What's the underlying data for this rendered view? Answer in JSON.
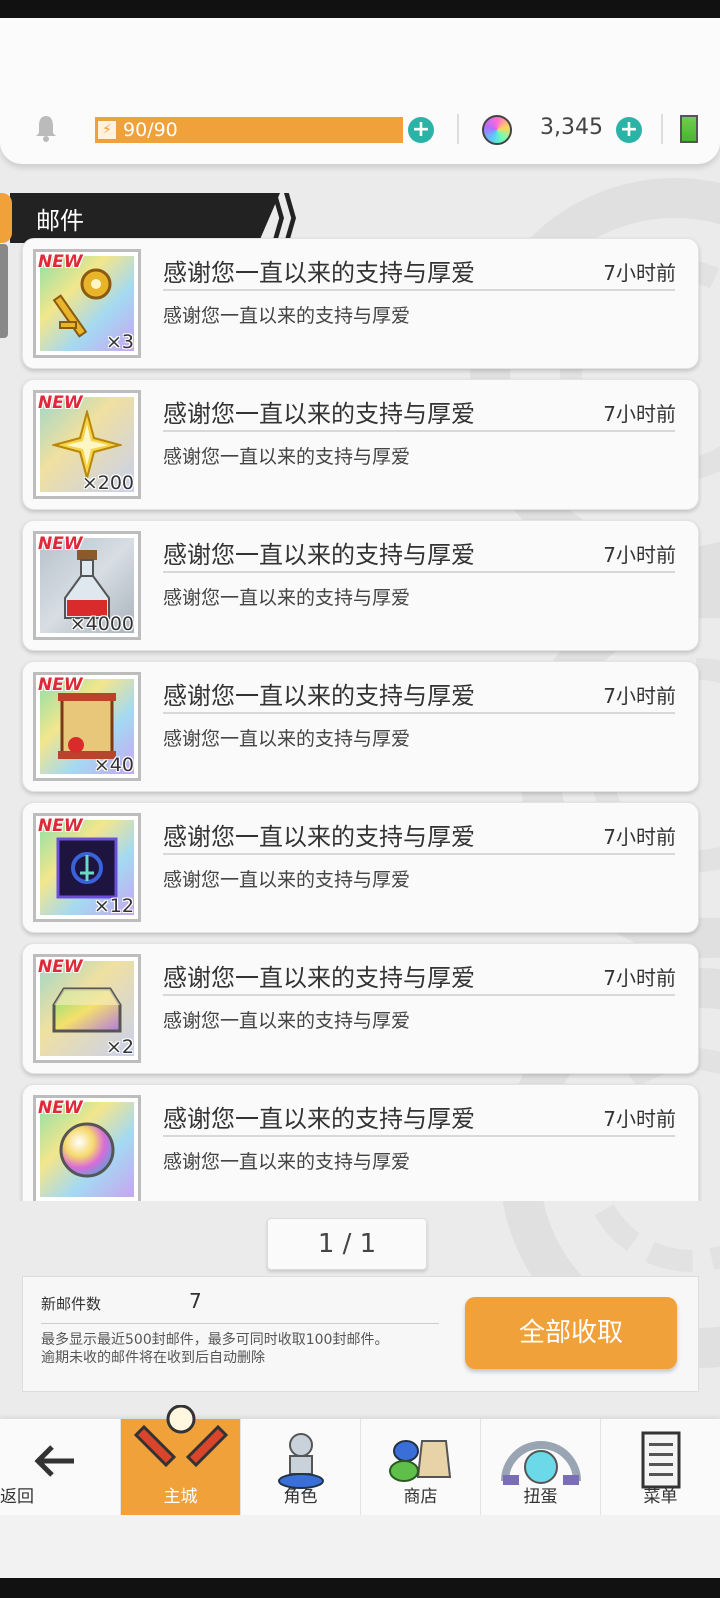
{
  "resources": {
    "energy_current": "90",
    "energy_max": "/90",
    "energy_level": 1.0,
    "gems": "3,345"
  },
  "header": {
    "title": "邮件"
  },
  "mails": [
    {
      "title": "感谢您一直以来的支持与厚爱",
      "subtitle": "感谢您一直以来的支持与厚爱",
      "time": "7小时前",
      "new": "NEW",
      "qty": "×3",
      "icon": "golden-key-icon"
    },
    {
      "title": "感谢您一直以来的支持与厚爱",
      "subtitle": "感谢您一直以来的支持与厚爱",
      "time": "7小时前",
      "new": "NEW",
      "qty": "×200",
      "icon": "star-shard-icon"
    },
    {
      "title": "感谢您一直以来的支持与厚爱",
      "subtitle": "感谢您一直以来的支持与厚爱",
      "time": "7小时前",
      "new": "NEW",
      "qty": "×4000",
      "icon": "potion-icon"
    },
    {
      "title": "感谢您一直以来的支持与厚爱",
      "subtitle": "感谢您一直以来的支持与厚爱",
      "time": "7小时前",
      "new": "NEW",
      "qty": "×40",
      "icon": "scroll-icon"
    },
    {
      "title": "感谢您一直以来的支持与厚爱",
      "subtitle": "感谢您一直以来的支持与厚爱",
      "time": "7小时前",
      "new": "NEW",
      "qty": "×12",
      "icon": "dark-rune-icon"
    },
    {
      "title": "感谢您一直以来的支持与厚爱",
      "subtitle": "感谢您一直以来的支持与厚爱",
      "time": "7小时前",
      "new": "NEW",
      "qty": "×2",
      "icon": "rainbow-ingot-icon"
    },
    {
      "title": "感谢您一直以来的支持与厚爱",
      "subtitle": "感谢您一直以来的支持与厚爱",
      "time": "7小时前",
      "new": "NEW",
      "qty": "",
      "icon": "rainbow-orb-icon"
    }
  ],
  "pager": {
    "text": "1 / 1"
  },
  "info": {
    "new_mail_label": "新邮件数",
    "new_mail_count": "7",
    "note_line1": "最多显示最近500封邮件，最多可同时收取100封邮件。",
    "note_line2": "逾期未收的邮件将在收到后自动删除",
    "collect_all": "全部收取"
  },
  "nav": {
    "back": "返回",
    "items": [
      {
        "label": "主城",
        "icon": "castle-icon",
        "active": true
      },
      {
        "label": "角色",
        "icon": "character-icon",
        "active": false
      },
      {
        "label": "商店",
        "icon": "shop-icon",
        "active": false
      },
      {
        "label": "扭蛋",
        "icon": "gacha-icon",
        "active": false
      },
      {
        "label": "菜单",
        "icon": "menu-icon",
        "active": false
      }
    ]
  },
  "colors": {
    "accent": "#f0a13a",
    "teal": "#2ab3a6",
    "new_red": "#e0283b"
  }
}
